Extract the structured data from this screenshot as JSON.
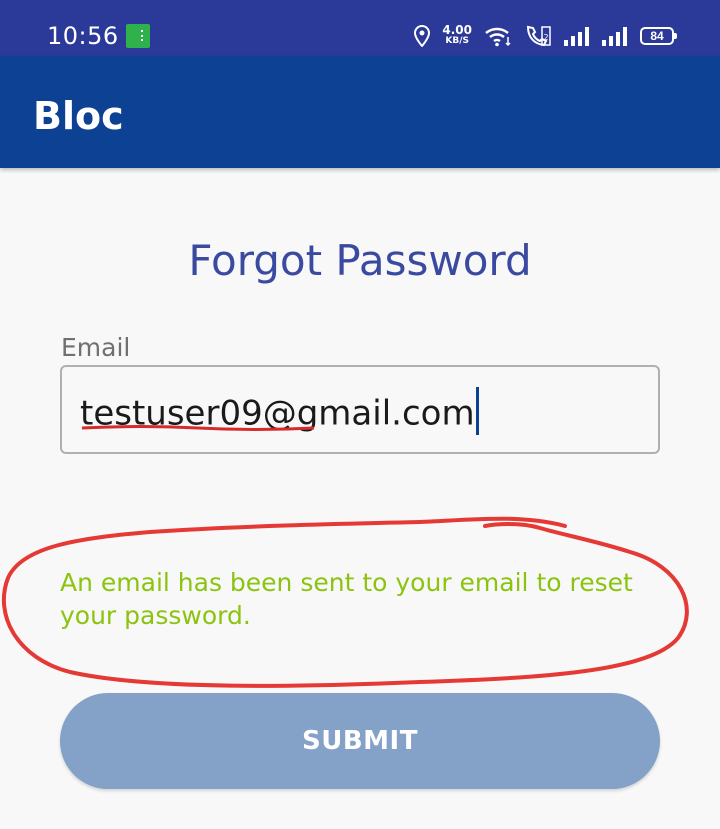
{
  "status_bar": {
    "time": "10:56",
    "network_speed_value": "4.00",
    "network_speed_unit": "KB/S",
    "battery_level": "84",
    "icons": [
      "sim-icon",
      "location-icon",
      "wifi-icon",
      "volte-call-icon",
      "signal-icon",
      "signal-icon",
      "battery-icon"
    ]
  },
  "app_bar": {
    "title": "Bloc",
    "color": "#0c4194"
  },
  "form": {
    "title": "Forgot Password",
    "email_label": "Email",
    "email_value": "testuser09@gmail.com",
    "message": "An email has been sent to your email to reset your password.",
    "message_color": "#8bc40e",
    "submit_label": "SUBMIT"
  },
  "colors": {
    "status_bar": "#2b3a98",
    "title": "#3a4aa0",
    "submit": "#84a1c8",
    "annotation": "#e53935"
  }
}
